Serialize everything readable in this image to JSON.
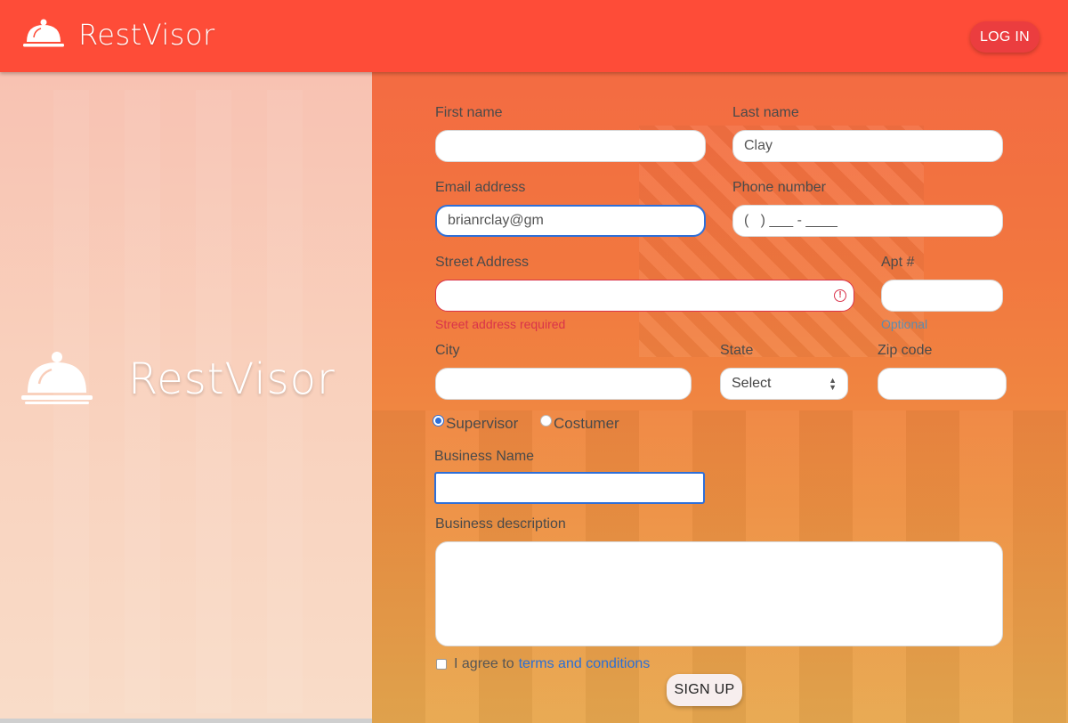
{
  "header": {
    "brand_name": "RestVisor",
    "login_label": "LOG IN",
    "logo_icon": "cloche-icon"
  },
  "left_panel": {
    "brand_name": "RestVisor",
    "logo_icon": "cloche-icon"
  },
  "form": {
    "first_name": {
      "label": "First name",
      "value": ""
    },
    "last_name": {
      "label": "Last name",
      "value": "Clay"
    },
    "email": {
      "label": "Email address",
      "value": "brianrclay@gm"
    },
    "phone": {
      "label": "Phone number",
      "value": "(   ) ___ - ____"
    },
    "street": {
      "label": "Street Address",
      "value": "",
      "error": "Street address required"
    },
    "apt": {
      "label": "Apt #",
      "value": "",
      "hint": "Optional"
    },
    "city": {
      "label": "City",
      "value": ""
    },
    "state": {
      "label": "State",
      "selected": "Select"
    },
    "zip": {
      "label": "Zip code",
      "value": ""
    },
    "role_options": [
      {
        "label": "Supervisor",
        "checked": true
      },
      {
        "label": "Costumer",
        "checked": false
      }
    ],
    "business_name": {
      "label": "Business Name",
      "value": ""
    },
    "business_description": {
      "label": "Business description",
      "value": ""
    },
    "terms": {
      "prefix": "I agree to",
      "link": "terms and conditions",
      "checked": false
    },
    "signup_label": "SIGN UP"
  },
  "colors": {
    "header_bg": "#fe4c38",
    "login_bg": "#eb3d3f",
    "focus_border": "#2e6fd8",
    "error": "#d9334a",
    "link": "#2a6fd6"
  }
}
